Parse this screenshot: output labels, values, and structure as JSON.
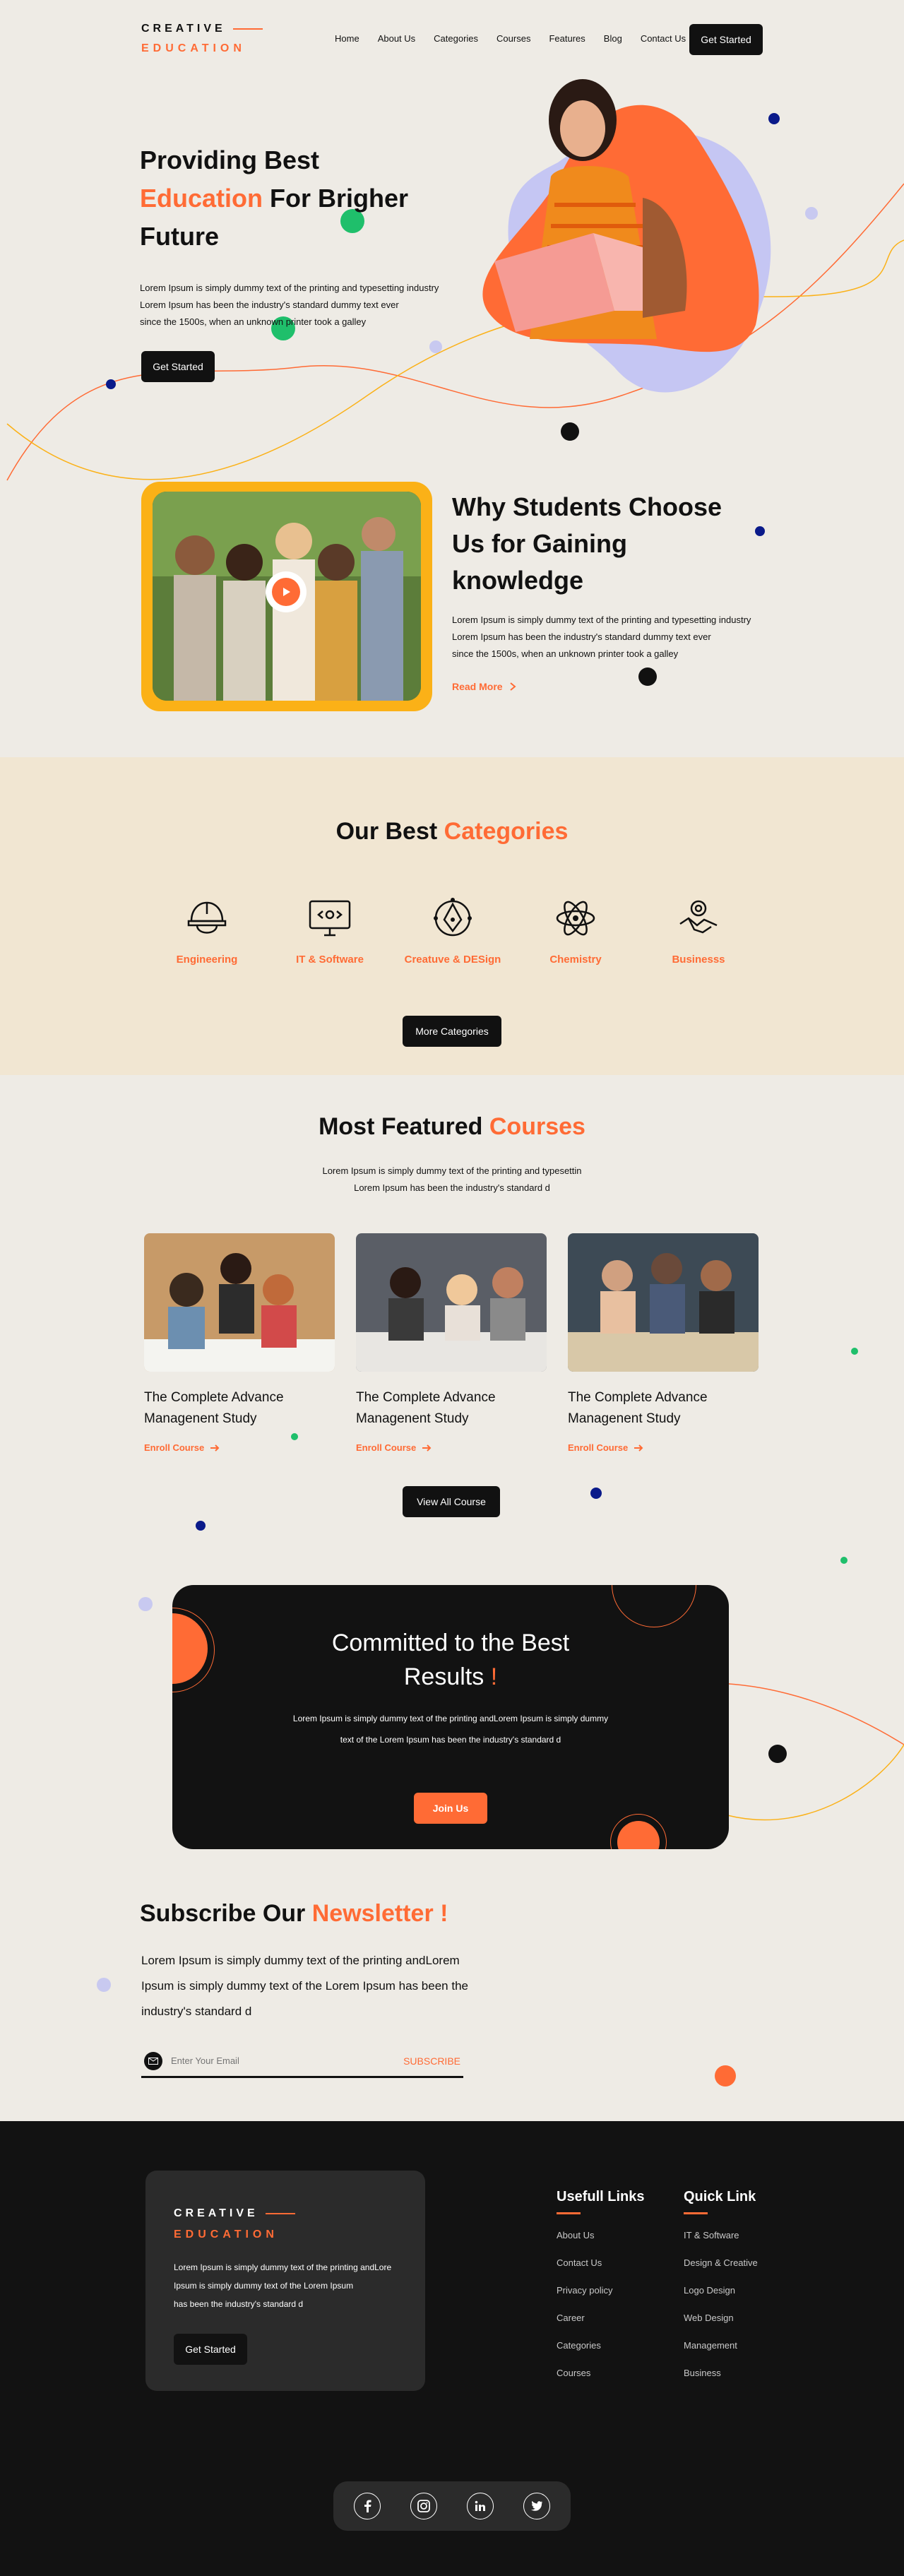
{
  "nav": {
    "logo_top": "CREATIVE",
    "logo_bottom": "EDUCATION",
    "links": [
      "Home",
      "About Us",
      "Categories",
      "Courses",
      "Features",
      "Blog",
      "Contact Us"
    ],
    "cta": "Get Started"
  },
  "hero": {
    "title_line1": "Providing Best",
    "title_accent": "Education",
    "title_rest": " For Brigher",
    "title_line3": "Future",
    "text_line1": "Lorem Ipsum is simply dummy text of the printing and typesetting industry",
    "text_line2": "Lorem Ipsum has been the industry's standard dummy text ever",
    "text_line3": "since the 1500s, when an unknown printer took a galley",
    "cta": "Get Started"
  },
  "why": {
    "title_line1": "Why Students Choose",
    "title_line2": "Us for Gaining",
    "title_line3": "knowledge",
    "text_line1": "Lorem Ipsum is simply dummy text of the printing and typesetting industry",
    "text_line2": "Lorem Ipsum has been the industry's standard dummy text ever",
    "text_line3": "since the 1500s, when an unknown printer took a galley",
    "read_more": "Read More"
  },
  "categories": {
    "title": "Our Best ",
    "title_accent": "Categories",
    "items": [
      {
        "label": "Engineering",
        "icon": "helmet-icon"
      },
      {
        "label": "IT & Software",
        "icon": "monitor-code-icon"
      },
      {
        "label": "Creatuve & DESign",
        "icon": "pen-nib-icon"
      },
      {
        "label": "Chemistry",
        "icon": "atom-icon"
      },
      {
        "label": "Businesss",
        "icon": "handshake-gear-icon"
      }
    ],
    "more": "More Categories"
  },
  "courses": {
    "title": "Most Featured ",
    "title_accent": "Courses",
    "sub_line1": "Lorem Ipsum is simply dummy text of the printing and typesettin",
    "sub_line2": "Lorem Ipsum has been the industry's standard d",
    "items": [
      {
        "title_line1": "The Complete Advance",
        "title_line2": "Managenent Study",
        "enroll": "Enroll Course"
      },
      {
        "title_line1": "The Complete Advance",
        "title_line2": "Managenent Study",
        "enroll": "Enroll Course"
      },
      {
        "title_line1": "The Complete Advance",
        "title_line2": "Managenent Study",
        "enroll": "Enroll Course"
      }
    ],
    "view_all": "View All Course"
  },
  "committed": {
    "title_line1": "Committed to the Best",
    "title_line2": "Results ",
    "title_mark": "!",
    "text_line1": "Lorem Ipsum is simply dummy text of the printing andLorem Ipsum is simply dummy",
    "text_line2": "text of the Lorem Ipsum has been the industry's standard d",
    "cta": "Join Us"
  },
  "newsletter": {
    "title": "Subscribe Our ",
    "title_accent": "Newsletter !",
    "text_line1": "Lorem Ipsum is simply dummy text of the printing andLorem",
    "text_line2": "Ipsum is simply dummy text of the Lorem Ipsum has been the",
    "text_line3": "industry's standard d",
    "placeholder": "Enter Your Email",
    "subscribe": "SUBSCRIBE"
  },
  "footer": {
    "logo_top": "CREATIVE",
    "logo_bottom": "EDUCATION",
    "text_line1": "Lorem Ipsum is simply dummy text of the printing andLore",
    "text_line2": "Ipsum is simply dummy text of the Lorem Ipsum",
    "text_line3": "has been the industry's standard d",
    "cta": "Get Started",
    "useful_title": "Usefull Links",
    "useful_links": [
      "About Us",
      "Contact Us",
      "Privacy policy",
      "Career",
      "Categories",
      "Courses"
    ],
    "quick_title": "Quick Link",
    "quick_links": [
      "IT & Software",
      "Design & Creative",
      "Logo Design",
      "Web Design",
      "Management",
      "Business"
    ],
    "social": [
      "facebook-icon",
      "instagram-icon",
      "linkedin-icon",
      "twitter-icon"
    ]
  },
  "colors": {
    "accent": "#ff6b35",
    "dark": "#121212",
    "bg": "#eeebe5",
    "cream": "#f1e6d2",
    "yellow": "#fbb117"
  }
}
